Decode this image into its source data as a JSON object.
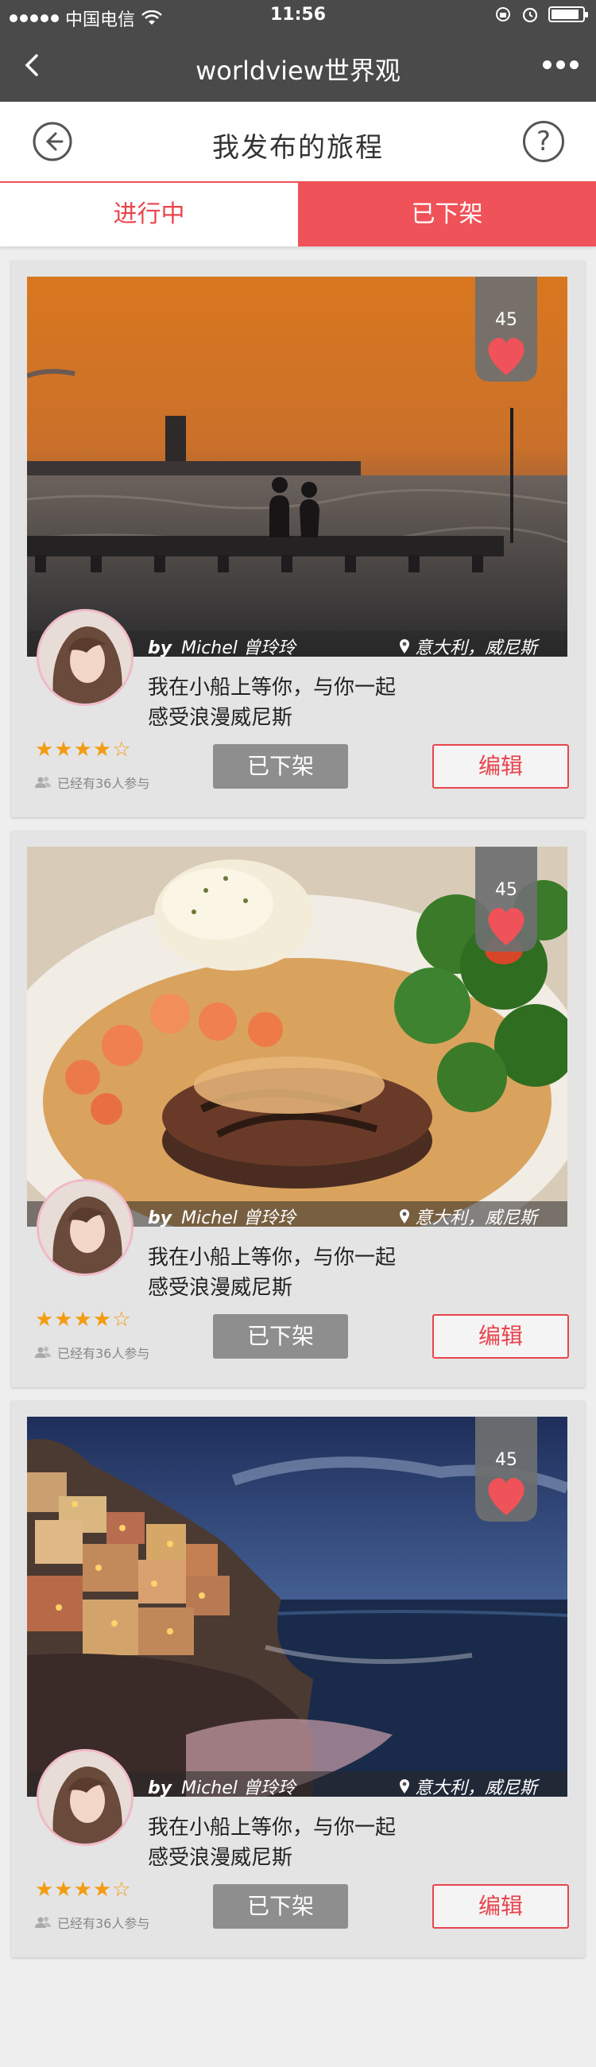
{
  "status_bar": {
    "carrier": "中国电信",
    "time": "11:56"
  },
  "nav": {
    "title": "worldview世界观"
  },
  "page": {
    "title": "我发布的旅程",
    "help_glyph": "?"
  },
  "tabs": [
    {
      "label": "进行中",
      "active": false
    },
    {
      "label": "已下架",
      "active": true
    }
  ],
  "colors": {
    "accent": "#ef5258",
    "accent_text": "#e8454d",
    "nav_bg": "#4a4a4a",
    "star": "#f39c12"
  },
  "trips": [
    {
      "likes": "45",
      "by_label": "by",
      "author": "Michel 曾玲玲",
      "location": "意大利，威尼斯",
      "title_line1": "我在小船上等你，与你一起",
      "title_line2": "感受浪漫威尼斯",
      "rating": 4,
      "stars": "★★★★☆",
      "joined": "已经有36人参与",
      "offline_label": "已下架",
      "edit_label": "编辑",
      "photo": "sunset-pier"
    },
    {
      "likes": "45",
      "by_label": "by",
      "author": "Michel 曾玲玲",
      "location": "意大利，威尼斯",
      "title_line1": "我在小船上等你，与你一起",
      "title_line2": "感受浪漫威尼斯",
      "rating": 4,
      "stars": "★★★★☆",
      "joined": "已经有36人参与",
      "offline_label": "已下架",
      "edit_label": "编辑",
      "photo": "steak-shrimp"
    },
    {
      "likes": "45",
      "by_label": "by",
      "author": "Michel 曾玲玲",
      "location": "意大利，威尼斯",
      "title_line1": "我在小船上等你，与你一起",
      "title_line2": "感受浪漫威尼斯",
      "rating": 4,
      "stars": "★★★★☆",
      "joined": "已经有36人参与",
      "offline_label": "已下架",
      "edit_label": "编辑",
      "photo": "coastal-village-night"
    }
  ]
}
